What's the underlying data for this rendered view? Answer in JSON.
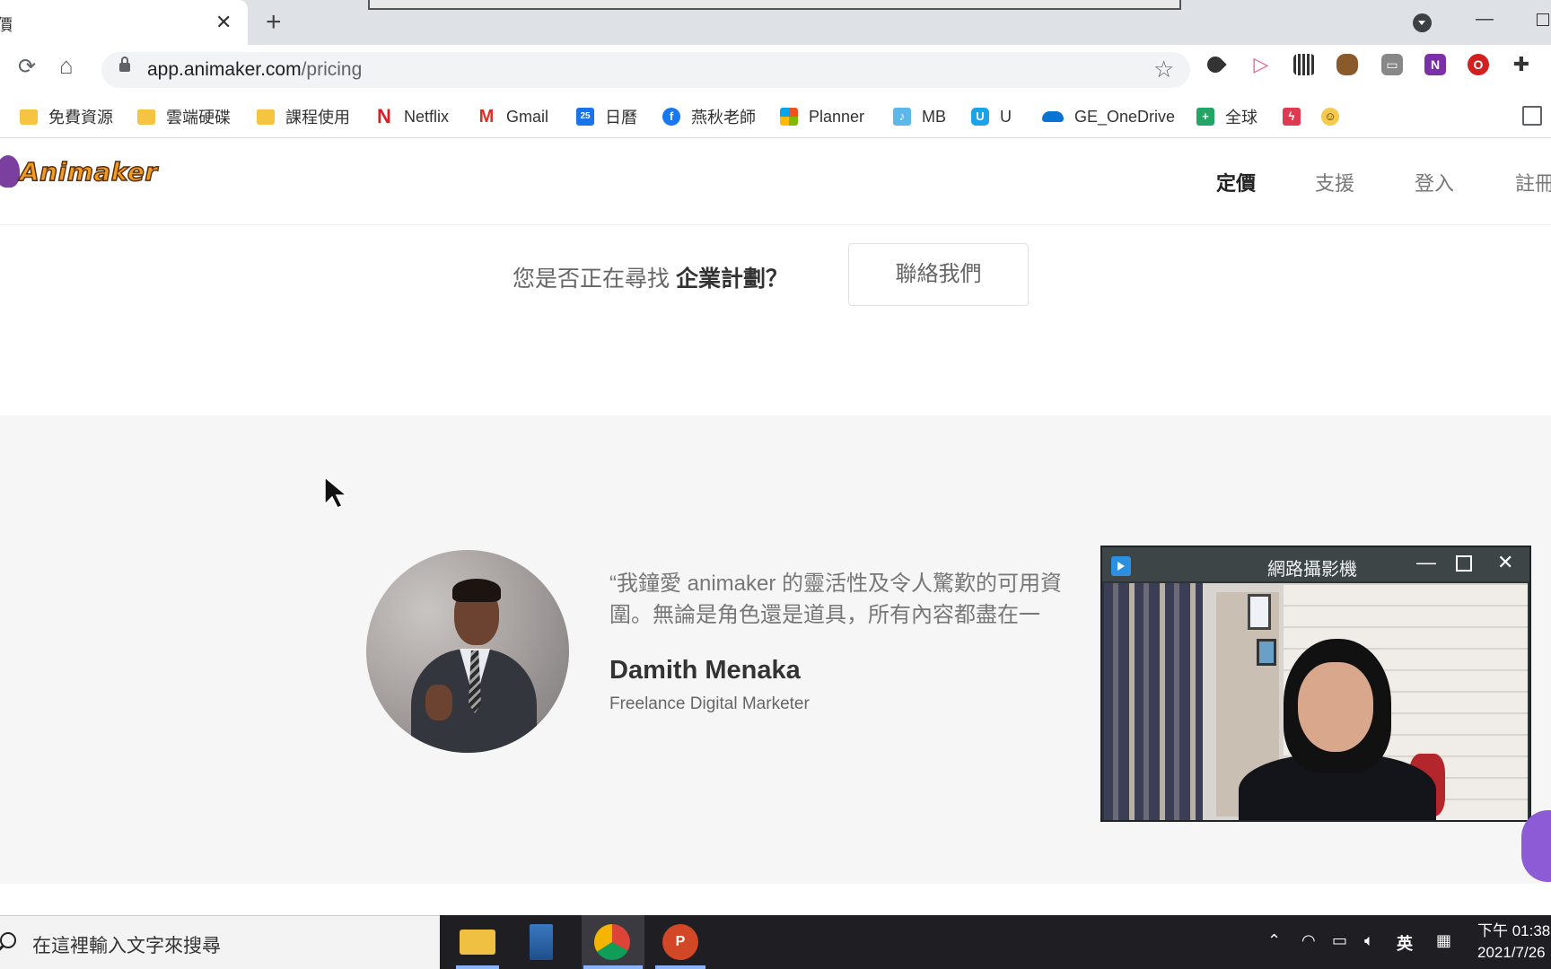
{
  "browser": {
    "tab_title": "價",
    "url_host": "app.animaker.com",
    "url_path": "/pricing",
    "bookmarks": [
      {
        "label": "免費資源",
        "icon": "folder-icon"
      },
      {
        "label": "雲端硬碟",
        "icon": "folder-icon"
      },
      {
        "label": "課程使用",
        "icon": "folder-icon"
      },
      {
        "label": "Netflix",
        "icon": "netflix-icon"
      },
      {
        "label": "Gmail",
        "icon": "gmail-icon"
      },
      {
        "label": "日曆",
        "icon": "calendar-icon"
      },
      {
        "label": "燕秋老師",
        "icon": "facebook-icon"
      },
      {
        "label": "Planner",
        "icon": "planner-icon"
      },
      {
        "label": "MB",
        "icon": "mb-icon"
      },
      {
        "label": "U",
        "icon": "u-icon"
      },
      {
        "label": "GE_OneDrive",
        "icon": "onedrive-icon"
      },
      {
        "label": "全球",
        "icon": "globe-icon"
      },
      {
        "label": "",
        "icon": "flash-icon"
      },
      {
        "label": "",
        "icon": "emoji-icon"
      }
    ]
  },
  "site": {
    "logo": "Animaker",
    "nav": [
      "定價",
      "支援",
      "登入",
      "註冊"
    ]
  },
  "enterprise": {
    "question_prefix": "您是否正在尋找",
    "question_bold": "企業計劃？",
    "contact_button": "聯絡我們"
  },
  "testimonial": {
    "quote_line1": "“我鐘愛 animaker 的靈活性及令人驚歎的可用資",
    "quote_line2": "圍。無論是角色還是道具，所有內容都盡在一",
    "author": "Damith Menaka",
    "role": "Freelance Digital Marketer"
  },
  "webcam": {
    "title": "網路攝影機"
  },
  "taskbar": {
    "search_placeholder": "在這裡輸入文字來搜尋",
    "ime": "英",
    "time": "下午 01:38",
    "date": "2021/7/26"
  },
  "colors": {
    "brand_orange": "#f29d1c",
    "brand_purple": "#7b3fa0",
    "chat_bubble": "#8d5bd6"
  }
}
